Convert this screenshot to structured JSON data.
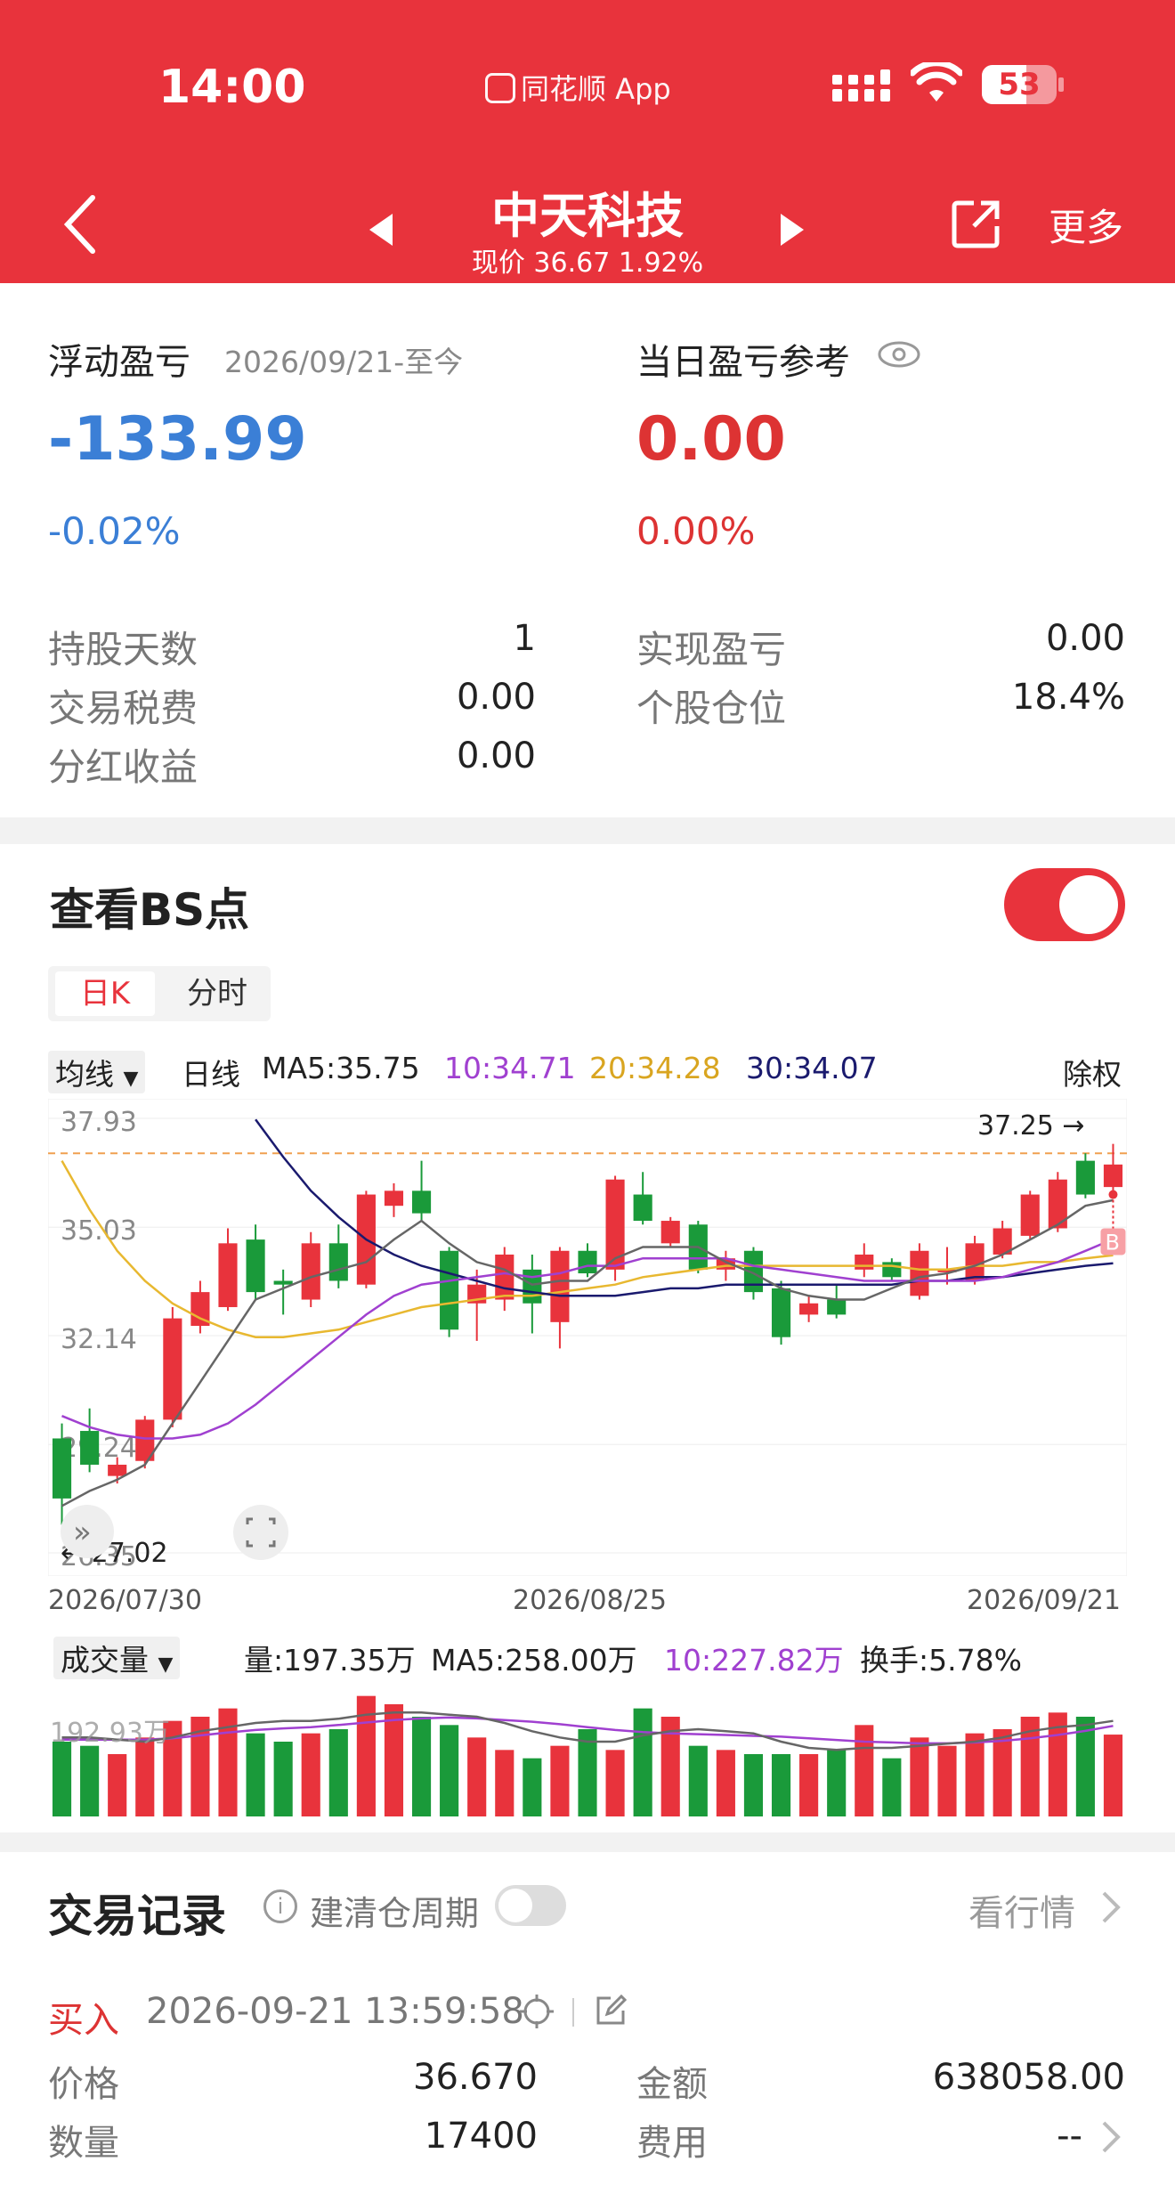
{
  "status_bar": {
    "time": "14:00",
    "app_name": "同花顺 App",
    "battery": "53"
  },
  "header": {
    "title": "中天科技",
    "subtitle": "现价 36.67 1.92%",
    "more_label": "更多"
  },
  "pnl": {
    "float_label": "浮动盈亏",
    "float_date": "2026/09/21-至今",
    "float_value": "-133.99",
    "float_pct": "-0.02%",
    "day_label": "当日盈亏参考",
    "day_value": "0.00",
    "day_pct": "0.00%",
    "rows_left": [
      {
        "label": "持股天数",
        "value": "1"
      },
      {
        "label": "交易税费",
        "value": "0.00"
      },
      {
        "label": "分红收益",
        "value": "0.00"
      }
    ],
    "rows_right": [
      {
        "label": "实现盈亏",
        "value": "0.00"
      },
      {
        "label": "个股仓位",
        "value": "18.4%"
      }
    ]
  },
  "bs": {
    "title": "查看BS点",
    "tabs": [
      "日K",
      "分时"
    ],
    "ma_dropdown": "均线",
    "ma_period": "日线",
    "ma5": "MA5:35.75",
    "ma10": "10:34.71",
    "ma20": "20:34.28",
    "ma30": "30:34.07",
    "adjust": "除权",
    "colors": {
      "up": "#e8333c",
      "down": "#1a9a3a",
      "ma5": "#666666",
      "ma10": "#a040d0",
      "ma20": "#e8b830",
      "ma30": "#1a1a6e"
    },
    "y_ticks": [
      "37.93",
      "35.03",
      "32.14",
      "29.24",
      "26.35"
    ],
    "high_label": "37.25",
    "low_label": "27.02",
    "x_labels": [
      "2026/07/30",
      "2026/08/25",
      "2026/09/21"
    ],
    "buy_marker": "B",
    "vol_dropdown": "成交量",
    "vol_text": "量:197.35万",
    "vol_ma5": "MA5:258.00万",
    "vol_ma10": "10:227.82万",
    "turnover": "换手:5.78%",
    "vol_tick": "192.93万"
  },
  "chart_data": {
    "type": "candlestick",
    "candles": [
      {
        "o": 27.8,
        "c": 29.4,
        "h": 29.8,
        "l": 27.1,
        "up": false
      },
      {
        "o": 29.6,
        "c": 28.7,
        "h": 30.2,
        "l": 28.5,
        "up": false
      },
      {
        "o": 28.4,
        "c": 28.7,
        "h": 28.9,
        "l": 28.2,
        "up": true
      },
      {
        "o": 28.8,
        "c": 29.9,
        "h": 30.0,
        "l": 28.6,
        "up": true
      },
      {
        "o": 29.9,
        "c": 32.6,
        "h": 32.9,
        "l": 29.7,
        "up": true
      },
      {
        "o": 32.4,
        "c": 33.3,
        "h": 33.6,
        "l": 32.2,
        "up": true
      },
      {
        "o": 32.9,
        "c": 34.6,
        "h": 35.0,
        "l": 32.8,
        "up": true
      },
      {
        "o": 34.7,
        "c": 33.3,
        "h": 35.1,
        "l": 33.1,
        "up": false
      },
      {
        "o": 33.5,
        "c": 33.6,
        "h": 33.9,
        "l": 32.7,
        "up": false
      },
      {
        "o": 33.1,
        "c": 34.6,
        "h": 34.9,
        "l": 32.9,
        "up": true
      },
      {
        "o": 34.6,
        "c": 33.6,
        "h": 35.1,
        "l": 33.4,
        "up": false
      },
      {
        "o": 33.5,
        "c": 35.9,
        "h": 36.0,
        "l": 33.4,
        "up": true
      },
      {
        "o": 35.6,
        "c": 36.0,
        "h": 36.2,
        "l": 35.3,
        "up": true
      },
      {
        "o": 36.0,
        "c": 35.4,
        "h": 36.8,
        "l": 35.2,
        "up": false
      },
      {
        "o": 34.4,
        "c": 32.3,
        "h": 34.5,
        "l": 32.1,
        "up": false
      },
      {
        "o": 33.0,
        "c": 33.5,
        "h": 33.9,
        "l": 32.0,
        "up": true
      },
      {
        "o": 33.1,
        "c": 34.3,
        "h": 34.5,
        "l": 32.8,
        "up": true
      },
      {
        "o": 33.9,
        "c": 33.0,
        "h": 34.3,
        "l": 32.2,
        "up": false
      },
      {
        "o": 32.5,
        "c": 34.4,
        "h": 34.5,
        "l": 31.8,
        "up": true
      },
      {
        "o": 34.4,
        "c": 33.8,
        "h": 34.6,
        "l": 33.7,
        "up": false
      },
      {
        "o": 33.9,
        "c": 36.3,
        "h": 36.4,
        "l": 33.6,
        "up": true
      },
      {
        "o": 35.9,
        "c": 35.2,
        "h": 36.5,
        "l": 35.1,
        "up": false
      },
      {
        "o": 34.6,
        "c": 35.2,
        "h": 35.3,
        "l": 34.5,
        "up": true
      },
      {
        "o": 35.1,
        "c": 33.9,
        "h": 35.2,
        "l": 33.8,
        "up": false
      },
      {
        "o": 33.9,
        "c": 34.2,
        "h": 34.4,
        "l": 33.6,
        "up": true
      },
      {
        "o": 34.4,
        "c": 33.3,
        "h": 34.5,
        "l": 33.1,
        "up": false
      },
      {
        "o": 33.4,
        "c": 32.1,
        "h": 33.6,
        "l": 31.9,
        "up": false
      },
      {
        "o": 32.7,
        "c": 33.0,
        "h": 33.2,
        "l": 32.5,
        "up": true
      },
      {
        "o": 33.1,
        "c": 32.7,
        "h": 33.5,
        "l": 32.6,
        "up": false
      },
      {
        "o": 33.9,
        "c": 34.3,
        "h": 34.6,
        "l": 33.7,
        "up": true
      },
      {
        "o": 34.1,
        "c": 33.7,
        "h": 34.2,
        "l": 33.6,
        "up": false
      },
      {
        "o": 33.2,
        "c": 34.4,
        "h": 34.6,
        "l": 33.1,
        "up": true
      },
      {
        "o": 33.9,
        "c": 33.9,
        "h": 34.5,
        "l": 33.5,
        "up": true
      },
      {
        "o": 33.6,
        "c": 34.6,
        "h": 34.8,
        "l": 33.5,
        "up": true
      },
      {
        "o": 34.3,
        "c": 35.0,
        "h": 35.2,
        "l": 34.2,
        "up": true
      },
      {
        "o": 34.8,
        "c": 35.9,
        "h": 36.0,
        "l": 34.7,
        "up": true
      },
      {
        "o": 35.0,
        "c": 36.3,
        "h": 36.5,
        "l": 34.9,
        "up": true
      },
      {
        "o": 35.9,
        "c": 36.8,
        "h": 37.0,
        "l": 35.8,
        "up": false
      },
      {
        "o": 36.1,
        "c": 36.7,
        "h": 37.25,
        "l": 35.9,
        "up": true
      }
    ],
    "ma5": [
      27.6,
      28.0,
      28.3,
      28.7,
      29.8,
      30.9,
      32.0,
      33.1,
      33.4,
      33.7,
      33.9,
      34.1,
      34.7,
      35.2,
      34.6,
      34.1,
      33.9,
      33.5,
      33.6,
      33.6,
      34.2,
      34.5,
      34.5,
      34.5,
      34.1,
      33.8,
      33.4,
      33.2,
      33.1,
      33.1,
      33.4,
      33.7,
      33.8,
      34.0,
      34.3,
      34.7,
      35.1,
      35.6,
      35.75
    ],
    "ma10": [
      30.0,
      29.7,
      29.5,
      29.4,
      29.4,
      29.5,
      29.8,
      30.3,
      30.9,
      31.5,
      32.1,
      32.7,
      33.2,
      33.5,
      33.6,
      33.7,
      33.8,
      33.7,
      33.8,
      34.0,
      34.0,
      34.2,
      34.2,
      34.2,
      34.2,
      34.0,
      33.9,
      33.8,
      33.7,
      33.6,
      33.6,
      33.6,
      33.6,
      33.6,
      33.7,
      33.9,
      34.1,
      34.4,
      34.71
    ],
    "ma20": [
      36.8,
      35.5,
      34.4,
      33.6,
      33.0,
      32.6,
      32.3,
      32.1,
      32.1,
      32.2,
      32.3,
      32.5,
      32.7,
      32.9,
      33.0,
      33.1,
      33.2,
      33.2,
      33.3,
      33.4,
      33.5,
      33.7,
      33.8,
      33.9,
      34.0,
      34.0,
      34.0,
      34.0,
      34.0,
      34.0,
      34.0,
      33.9,
      33.9,
      34.0,
      34.0,
      34.1,
      34.1,
      34.2,
      34.28
    ],
    "ma30": [
      null,
      null,
      null,
      null,
      null,
      null,
      null,
      37.9,
      36.9,
      36.0,
      35.3,
      34.7,
      34.3,
      34.0,
      33.8,
      33.6,
      33.4,
      33.3,
      33.2,
      33.2,
      33.2,
      33.3,
      33.4,
      33.4,
      33.5,
      33.5,
      33.5,
      33.5,
      33.5,
      33.5,
      33.5,
      33.6,
      33.6,
      33.7,
      33.7,
      33.8,
      33.9,
      34.0,
      34.07
    ],
    "volume": [
      180,
      170,
      150,
      190,
      230,
      240,
      260,
      200,
      180,
      200,
      210,
      290,
      270,
      240,
      220,
      190,
      160,
      140,
      170,
      210,
      160,
      260,
      240,
      170,
      160,
      150,
      150,
      150,
      160,
      220,
      140,
      190,
      170,
      200,
      210,
      240,
      250,
      240,
      197
    ],
    "vol_ma5": [
      190,
      190,
      185,
      180,
      190,
      205,
      215,
      225,
      230,
      230,
      235,
      245,
      250,
      250,
      245,
      240,
      225,
      205,
      190,
      180,
      180,
      195,
      205,
      210,
      205,
      200,
      180,
      165,
      160,
      165,
      165,
      170,
      175,
      180,
      190,
      205,
      215,
      220,
      230
    ],
    "vol_ma10": [
      185,
      185,
      185,
      185,
      188,
      195,
      202,
      208,
      212,
      215,
      220,
      226,
      232,
      236,
      238,
      236,
      232,
      228,
      222,
      215,
      208,
      203,
      200,
      198,
      196,
      194,
      192,
      188,
      184,
      180,
      178,
      176,
      176,
      178,
      182,
      188,
      196,
      206,
      218
    ]
  },
  "trades": {
    "title": "交易记录",
    "cycle_label": "建清仓周期",
    "market_link": "看行情",
    "record": {
      "side": "买入",
      "datetime": "2026-09-21 13:59:58",
      "price_label": "价格",
      "price": "36.670",
      "amount_label": "金额",
      "amount": "638058.00",
      "qty_label": "数量",
      "qty": "17400",
      "fee_label": "费用",
      "fee": "--"
    }
  }
}
